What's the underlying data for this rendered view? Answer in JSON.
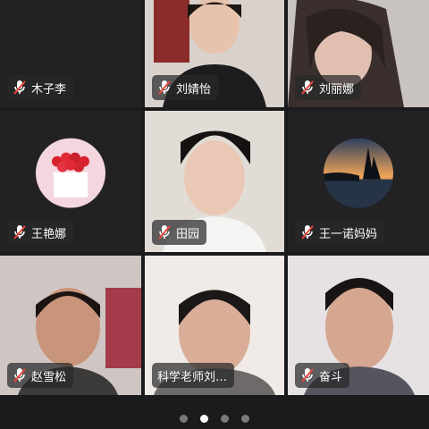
{
  "participants": [
    {
      "name": "木子李",
      "mic": "muted"
    },
    {
      "name": "刘婧怡",
      "mic": "muted"
    },
    {
      "name": "刘丽娜",
      "mic": "muted"
    },
    {
      "name": "王艳娜",
      "mic": "muted"
    },
    {
      "name": "田园",
      "mic": "muted"
    },
    {
      "name": "王一诺妈妈",
      "mic": "muted"
    },
    {
      "name": "赵雪松",
      "mic": "muted"
    },
    {
      "name": "科学老师刘…",
      "mic": "muted"
    },
    {
      "name": "奋斗",
      "mic": "muted"
    }
  ],
  "pager": {
    "pages": 4,
    "current": 2
  },
  "colors": {
    "muted_mic": "#e8453c",
    "tag_bg": "rgba(40,40,42,0.72)",
    "page_bg": "#1b1b1d"
  }
}
